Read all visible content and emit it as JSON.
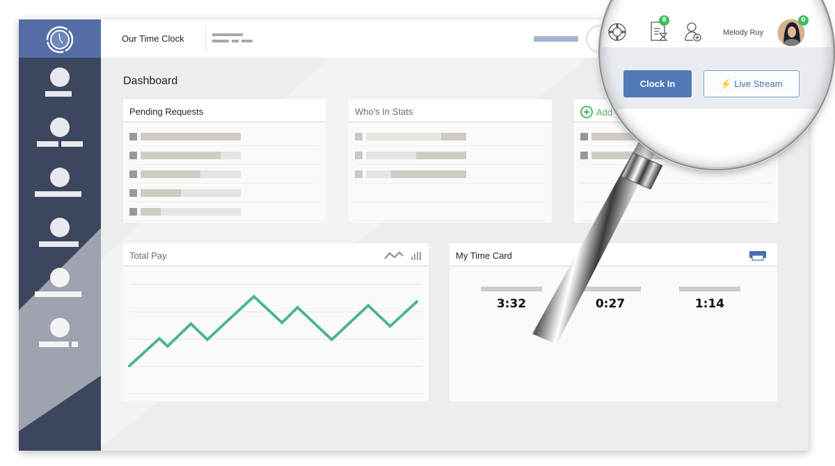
{
  "app": {
    "title": "Our Time Clock"
  },
  "sidebar": {
    "logo_icon": "clock-icon",
    "items": [
      {
        "name": "nav-item-1",
        "icon": "user-icon"
      },
      {
        "name": "nav-item-2",
        "icon": "user-icon"
      },
      {
        "name": "nav-item-3",
        "icon": "user-icon"
      },
      {
        "name": "nav-item-4",
        "icon": "user-icon"
      },
      {
        "name": "nav-item-5",
        "icon": "user-icon"
      },
      {
        "name": "nav-item-6",
        "icon": "user-icon"
      }
    ]
  },
  "header": {
    "icons": [
      "help-lifebuoy-icon",
      "timesheet-pending-icon",
      "add-user-icon"
    ],
    "timesheet_badge": "8",
    "user_name": "Melody Ruy",
    "avatar_badge": "0",
    "clock_in_label": "Clock In",
    "live_stream_label": "Live Stream",
    "live_stream_icon": "lightning-icon"
  },
  "main": {
    "page_title": "Dashboard",
    "pending_requests": {
      "title": "Pending Requests",
      "rows": [
        {
          "fill": 1.0
        },
        {
          "fill": 0.8
        },
        {
          "fill": 0.6
        },
        {
          "fill": 0.4
        },
        {
          "fill": 0.2
        }
      ]
    },
    "whos_in": {
      "title": "Who's In Stats",
      "rows": [
        {
          "fill": 0.25
        },
        {
          "fill": 0.5
        },
        {
          "fill": 0.75
        }
      ]
    },
    "add_widget": {
      "label": "Add",
      "icon": "plus-circle-icon"
    },
    "total_pay": {
      "title": "Total Pay",
      "view_icons": [
        "line-chart-icon",
        "bar-chart-icon"
      ],
      "line_color": "#4db39a"
    },
    "time_card": {
      "title": "My Time Card",
      "print_icon": "print-icon",
      "values": [
        "3:32",
        "0:27",
        "1:14"
      ]
    }
  },
  "colors": {
    "sidebar": "#3c465f",
    "logo_bg": "#546ea5",
    "primary": "#5079b5",
    "accent_green": "#4cb95a",
    "chart_line": "#4db39a",
    "badge": "#3bbf5f"
  },
  "chart_data": {
    "type": "line",
    "title": "Total Pay",
    "xlabel": "",
    "ylabel": "",
    "x": [
      0,
      1,
      2,
      3,
      4,
      5,
      6,
      7,
      8,
      9,
      10,
      11
    ],
    "x_positions": [
      0,
      0.104,
      0.133,
      0.214,
      0.271,
      0.433,
      0.531,
      0.585,
      0.704,
      0.831,
      0.907,
      1.0
    ],
    "series": [
      {
        "name": "Total Pay",
        "values": [
          1.02,
          2.02,
          1.74,
          2.56,
          1.98,
          3.56,
          2.6,
          3.16,
          1.98,
          3.23,
          2.47,
          3.37
        ]
      }
    ],
    "ylim": [
      0,
      4
    ],
    "gridlines": [
      0,
      1,
      2,
      3,
      4
    ],
    "grid": true,
    "legend": "none"
  }
}
